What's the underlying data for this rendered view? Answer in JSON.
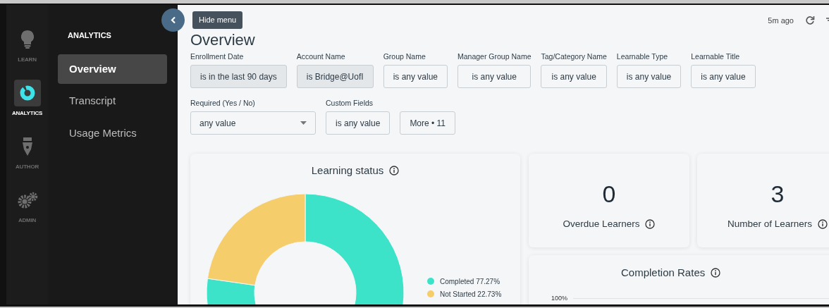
{
  "rail": [
    {
      "label": "LEARN",
      "kind": "learn",
      "selected": false
    },
    {
      "label": "ANALYTICS",
      "kind": "analytics",
      "selected": true
    },
    {
      "label": "AUTHOR",
      "kind": "author",
      "selected": false
    },
    {
      "label": "ADMIN",
      "kind": "admin",
      "selected": false
    }
  ],
  "nav": {
    "heading": "ANALYTICS",
    "items": [
      {
        "label": "Overview",
        "selected": true
      },
      {
        "label": "Transcript",
        "selected": false
      },
      {
        "label": "Usage Metrics",
        "selected": false
      }
    ]
  },
  "menu_toggle": {
    "tooltip": "Hide menu"
  },
  "page": {
    "title": "Overview",
    "updated": "5m ago"
  },
  "filter_rows": [
    [
      {
        "kind": "chip",
        "label": "Enrollment Date",
        "value": "is in the last 90 days",
        "applied": true
      },
      {
        "kind": "chip",
        "label": "Account Name",
        "value": "is Bridge@UofI",
        "applied": true
      },
      {
        "kind": "chip",
        "label": "Group Name",
        "value": "is any value",
        "applied": false
      },
      {
        "kind": "chip",
        "label": "Manager Group Name",
        "value": "is any value",
        "applied": false
      },
      {
        "kind": "chip",
        "label": "Tag/Category Name",
        "value": "is any value",
        "applied": false
      },
      {
        "kind": "chip",
        "label": "Learnable Type",
        "value": "is any value",
        "applied": false
      },
      {
        "kind": "chip",
        "label": "Learnable Title",
        "value": "is any value",
        "applied": false
      }
    ],
    [
      {
        "kind": "select",
        "label": "Required (Yes / No)",
        "value": "any value"
      },
      {
        "kind": "chip",
        "label": "Custom Fields",
        "value": "is any value",
        "applied": false
      },
      {
        "kind": "more",
        "value": "More • 11"
      }
    ]
  ],
  "learning_status": {
    "title": "Learning status",
    "chart_data": {
      "type": "donut",
      "values": [
        77.27,
        22.73
      ]
    },
    "legend": [
      {
        "label": "Completed 77.27%",
        "color": "#3de3c9"
      },
      {
        "label": "Not Started 22.73%",
        "color": "#f5cd6b"
      }
    ]
  },
  "stats": [
    {
      "value": "0",
      "label": "Overdue Learners"
    },
    {
      "value": "3",
      "label": "Number of Learners"
    }
  ],
  "completion_rates": {
    "title": "Completion Rates",
    "axis_label": "100%"
  }
}
